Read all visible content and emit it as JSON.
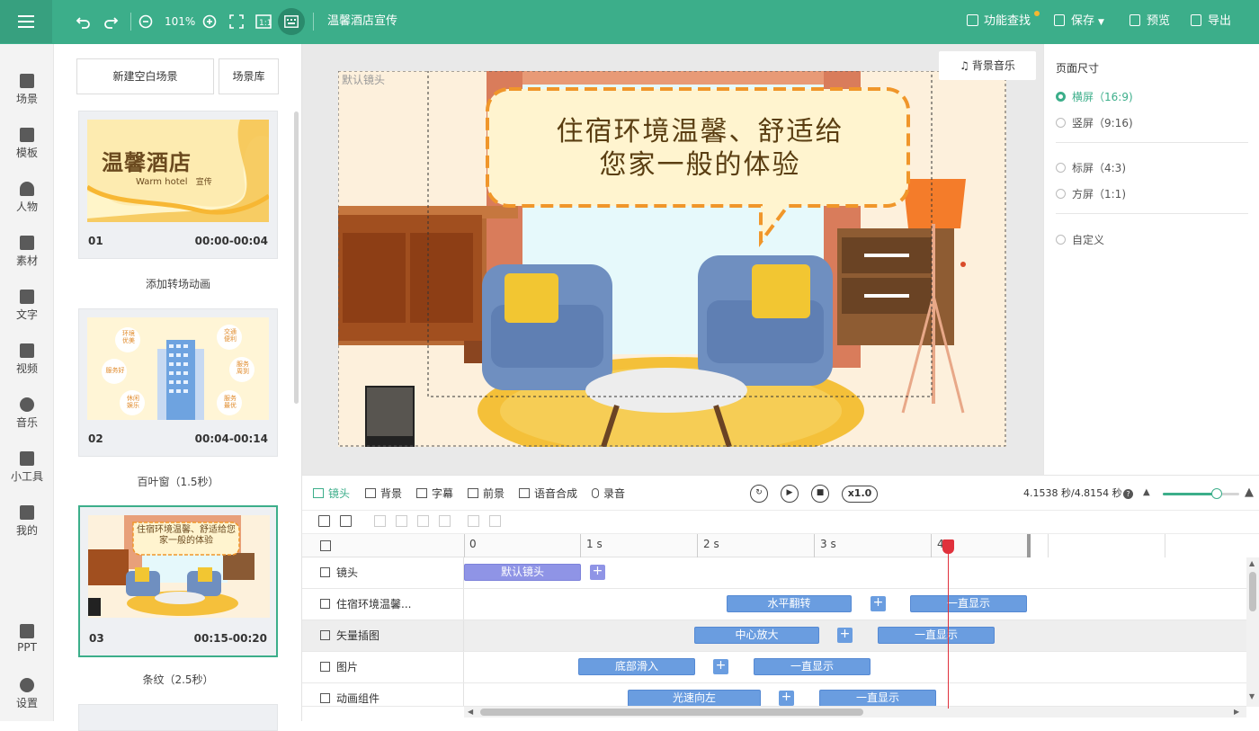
{
  "header": {
    "menu_icon": "hamburger-icon",
    "zoom": "101%",
    "title": "温馨酒店宣传",
    "function_search": "功能查找",
    "save": "保存",
    "preview": "预览",
    "export": "导出"
  },
  "left_nav": {
    "items": [
      {
        "label": "场景",
        "icon": "scene-icon"
      },
      {
        "label": "模板",
        "icon": "template-icon"
      },
      {
        "label": "人物",
        "icon": "person-icon"
      },
      {
        "label": "素材",
        "icon": "material-icon"
      },
      {
        "label": "文字",
        "icon": "text-icon"
      },
      {
        "label": "视频",
        "icon": "video-icon"
      },
      {
        "label": "音乐",
        "icon": "music-icon"
      },
      {
        "label": "小工具",
        "icon": "toolbox-icon"
      },
      {
        "label": "我的",
        "icon": "upload-icon"
      }
    ],
    "bottom_items": [
      {
        "label": "PPT",
        "icon": "ppt-icon"
      },
      {
        "label": "设置",
        "icon": "gear-icon"
      }
    ]
  },
  "scenes": {
    "new_blank": "新建空白场景",
    "library": "场景库",
    "list": [
      {
        "num": "01",
        "time": "00:00-00:04",
        "thumb_title": "温馨酒店",
        "thumb_sub": "Warm hotel",
        "thumb_sub2": "宣传"
      },
      {
        "num": "02",
        "time": "00:04-00:14"
      },
      {
        "num": "03",
        "time": "00:15-00:20",
        "thumb_title": "住宿环境温馨、舒适给您家一般的体验"
      }
    ],
    "transitions": [
      "添加转场动画",
      "百叶窗（1.5秒）",
      "条纹（2.5秒）"
    ],
    "scene02_bubbles": [
      "环境优美",
      "交通便利",
      "服务好",
      "服务周到",
      "休闲娱乐",
      "服务最优"
    ]
  },
  "canvas": {
    "default_camera": "默认镜头",
    "bg_music": "背景音乐",
    "speech_line1": "住宿环境温馨、舒适给",
    "speech_line2": "您家一般的体验"
  },
  "page_size": {
    "title": "页面尺寸",
    "options": [
      {
        "label": "横屏（16:9)",
        "selected": true
      },
      {
        "label": "竖屏（9:16)",
        "selected": false
      },
      {
        "label": "标屏（4:3)",
        "selected": false
      },
      {
        "label": "方屏（1:1)",
        "selected": false
      },
      {
        "label": "自定义",
        "selected": false
      }
    ]
  },
  "timeline": {
    "tabs": [
      "镜头",
      "背景",
      "字幕",
      "前景",
      "语音合成",
      "录音"
    ],
    "speed": "x1.0",
    "time": "4.1538 秒/4.8154 秒",
    "zoom_level": 0.7,
    "ruler": [
      "0",
      "1 s",
      "2 s",
      "3 s",
      "4"
    ],
    "tracks": [
      {
        "name": "镜头",
        "clips": [
          "默认镜头"
        ]
      },
      {
        "name": "住宿环境温馨...",
        "clips": [
          "水平翻转",
          "一直显示"
        ]
      },
      {
        "name": "矢量插图",
        "clips": [
          "中心放大",
          "一直显示"
        ]
      },
      {
        "name": "图片",
        "clips": [
          "底部滑入",
          "一直显示"
        ]
      },
      {
        "name": "动画组件",
        "clips": [
          "光速向左",
          "一直显示"
        ]
      }
    ]
  }
}
